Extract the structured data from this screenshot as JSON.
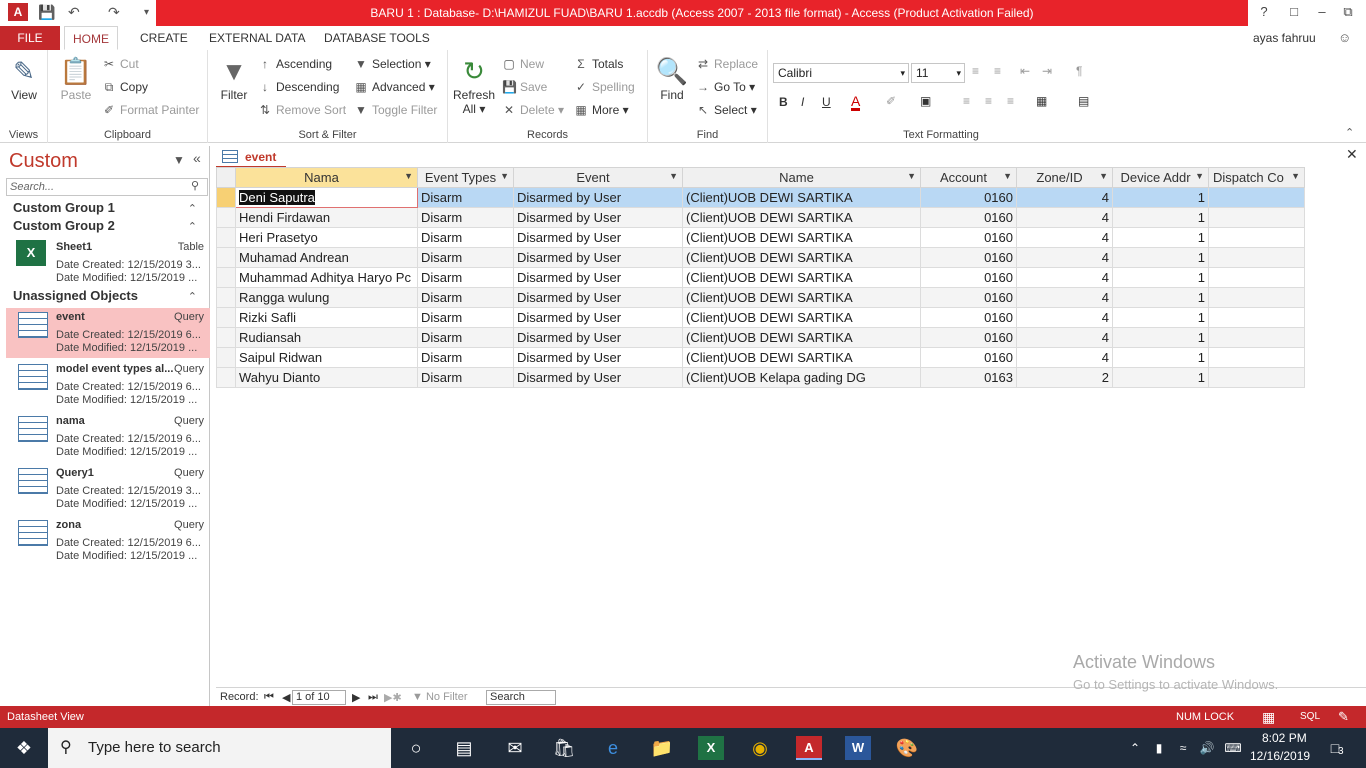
{
  "window": {
    "title": "BARU 1 : Database- D:\\HAMIZUL FUAD\\BARU 1.accdb (Access 2007 - 2013 file format) -  Access (Product Activation Failed)",
    "help": "?",
    "user": "ayas fahruu"
  },
  "tabs": [
    "FILE",
    "HOME",
    "CREATE",
    "EXTERNAL DATA",
    "DATABASE TOOLS"
  ],
  "ribbon": {
    "views": {
      "label": "Views",
      "view": "View"
    },
    "clipboard": {
      "label": "Clipboard",
      "paste": "Paste",
      "cut": "Cut",
      "copy": "Copy",
      "format_painter": "Format Painter"
    },
    "sort_filter": {
      "label": "Sort & Filter",
      "filter": "Filter",
      "ascending": "Ascending",
      "descending": "Descending",
      "remove_sort": "Remove Sort",
      "selection": "Selection",
      "advanced": "Advanced",
      "toggle_filter": "Toggle Filter"
    },
    "records": {
      "label": "Records",
      "refresh": "Refresh",
      "refresh_sub": "All",
      "new": "New",
      "save": "Save",
      "delete": "Delete",
      "totals": "Totals",
      "spelling": "Spelling",
      "more": "More"
    },
    "find": {
      "label": "Find",
      "find": "Find",
      "replace": "Replace",
      "goto": "Go To",
      "select": "Select"
    },
    "text_formatting": {
      "label": "Text Formatting",
      "font": "Calibri",
      "size": "11",
      "bold": "B",
      "italic": "I",
      "underline": "U",
      "font_color": "A"
    }
  },
  "nav": {
    "title": "Custom",
    "search_placeholder": "Search...",
    "groups": [
      "Custom Group 1",
      "Custom Group 2",
      "Unassigned Objects"
    ],
    "sheet": {
      "name": "Sheet1",
      "type": "Table",
      "created": "Date Created: 12/15/2019 3...",
      "modified": "Date Modified: 12/15/2019 ..."
    },
    "items": [
      {
        "name": "event",
        "type": "Query",
        "created": "Date Created: 12/15/2019 6...",
        "modified": "Date Modified: 12/15/2019 ..."
      },
      {
        "name": "model event types al...",
        "type": "Query",
        "created": "Date Created: 12/15/2019 6...",
        "modified": "Date Modified: 12/15/2019 ..."
      },
      {
        "name": "nama",
        "type": "Query",
        "created": "Date Created: 12/15/2019 6...",
        "modified": "Date Modified: 12/15/2019 ..."
      },
      {
        "name": "Query1",
        "type": "Query",
        "created": "Date Created: 12/15/2019 3...",
        "modified": "Date Modified: 12/15/2019 ..."
      },
      {
        "name": "zona",
        "type": "Query",
        "created": "Date Created: 12/15/2019 6...",
        "modified": "Date Modified: 12/15/2019 ..."
      }
    ]
  },
  "document": {
    "tab": "event",
    "columns": [
      "Nama",
      "Event Types",
      "Event",
      "Name",
      "Account",
      "Zone/ID",
      "Device Addr",
      "Dispatch Co"
    ],
    "rows": [
      [
        "Deni Saputra",
        "Disarm",
        "Disarmed by User",
        "(Client)UOB DEWI SARTIKA",
        "0160",
        "4",
        "1",
        ""
      ],
      [
        "Hendi Firdawan",
        "Disarm",
        "Disarmed by User",
        "(Client)UOB DEWI SARTIKA",
        "0160",
        "4",
        "1",
        ""
      ],
      [
        "Heri Prasetyo",
        "Disarm",
        "Disarmed by User",
        "(Client)UOB DEWI SARTIKA",
        "0160",
        "4",
        "1",
        ""
      ],
      [
        "Muhamad Andrean",
        "Disarm",
        "Disarmed by User",
        "(Client)UOB DEWI SARTIKA",
        "0160",
        "4",
        "1",
        ""
      ],
      [
        "Muhammad Adhitya Haryo Pc",
        "Disarm",
        "Disarmed by User",
        "(Client)UOB DEWI SARTIKA",
        "0160",
        "4",
        "1",
        ""
      ],
      [
        "Rangga wulung",
        "Disarm",
        "Disarmed by User",
        "(Client)UOB DEWI SARTIKA",
        "0160",
        "4",
        "1",
        ""
      ],
      [
        "Rizki Safli",
        "Disarm",
        "Disarmed by User",
        "(Client)UOB DEWI SARTIKA",
        "0160",
        "4",
        "1",
        ""
      ],
      [
        "Rudiansah",
        "Disarm",
        "Disarmed by User",
        "(Client)UOB DEWI SARTIKA",
        "0160",
        "4",
        "1",
        ""
      ],
      [
        "Saipul Ridwan",
        "Disarm",
        "Disarmed by User",
        "(Client)UOB DEWI SARTIKA",
        "0160",
        "4",
        "1",
        ""
      ],
      [
        "Wahyu Dianto",
        "Disarm",
        "Disarmed by User",
        "(Client)UOB Kelapa gading  DG",
        "0163",
        "2",
        "1",
        ""
      ]
    ],
    "record_nav": {
      "label": "Record:",
      "position": "1 of 10",
      "no_filter": "No Filter",
      "search": "Search"
    }
  },
  "status": {
    "left": "Datasheet View",
    "numlock": "NUM LOCK",
    "sql": "SQL"
  },
  "watermark": {
    "line1": "Activate Windows",
    "line2": "Go to Settings to activate Windows."
  },
  "taskbar": {
    "search_placeholder": "Type here to search",
    "time": "8:02 PM",
    "date": "12/16/2019",
    "notifications": "3"
  },
  "colors": {
    "accent": "#c4282b",
    "title_red": "#e8232a",
    "selected_row": "#b9d8f4",
    "sort_header": "#fbe29a"
  }
}
